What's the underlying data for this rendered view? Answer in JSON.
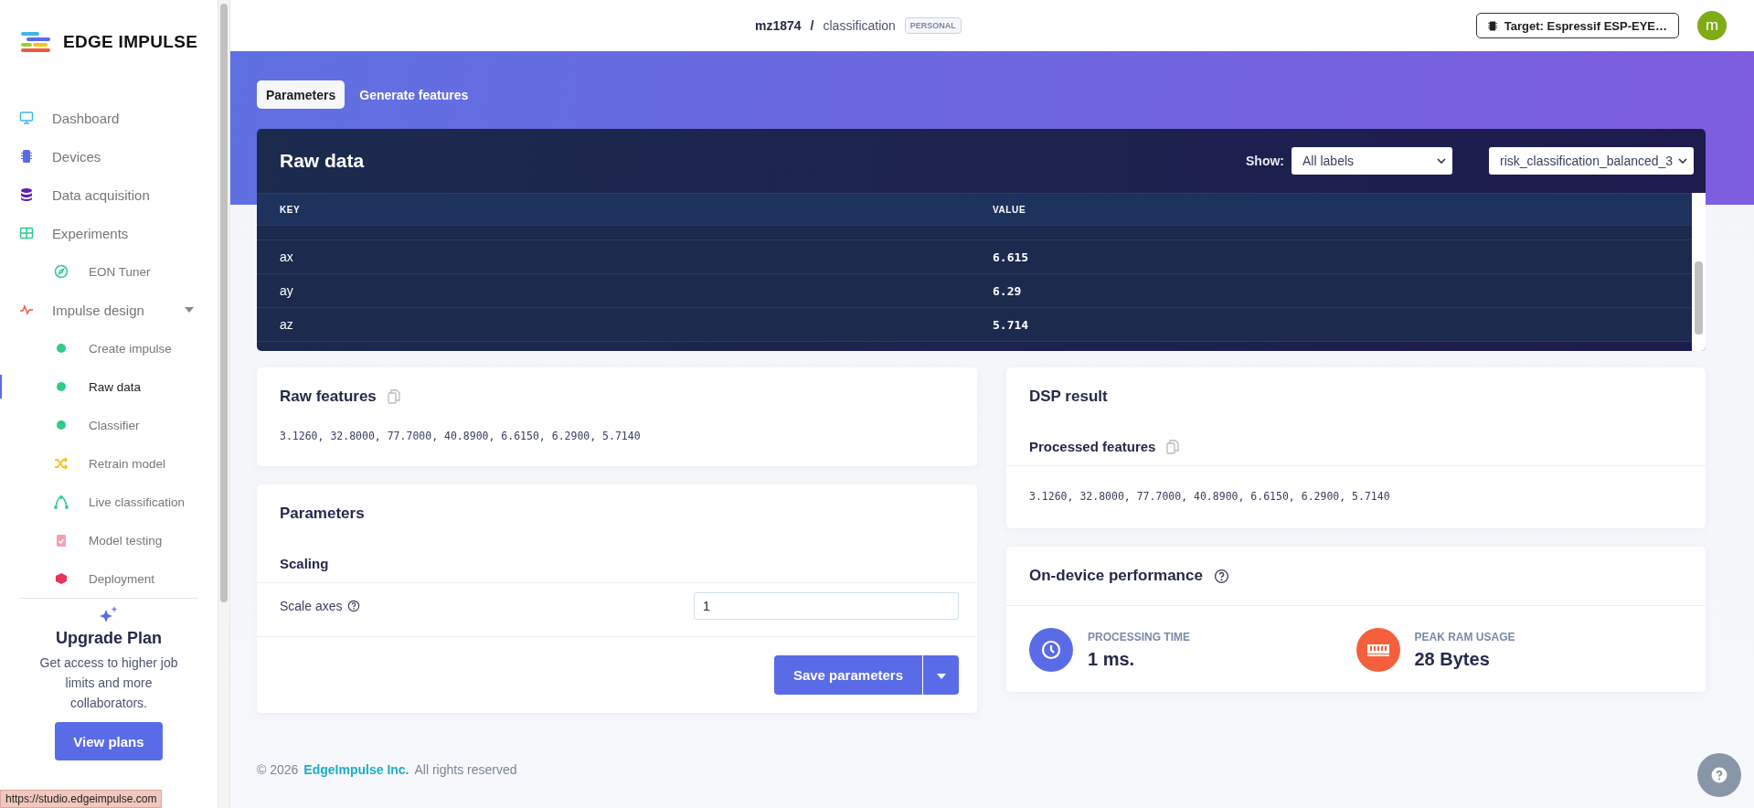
{
  "brand": {
    "name": "EDGE IMPULSE"
  },
  "sidebar": {
    "items": [
      {
        "label": "Dashboard",
        "selected": false
      },
      {
        "label": "Devices",
        "selected": false
      },
      {
        "label": "Data acquisition",
        "selected": false
      },
      {
        "label": "Experiments",
        "selected": false,
        "children": [
          {
            "label": "EON Tuner",
            "kind": "icon",
            "selected": false
          }
        ]
      },
      {
        "label": "Impulse design",
        "selected": false,
        "expanded": true,
        "children": [
          {
            "label": "Create impulse",
            "kind": "dot",
            "selected": false
          },
          {
            "label": "Raw data",
            "kind": "dot",
            "selected": true
          },
          {
            "label": "Classifier",
            "kind": "dot",
            "selected": false
          },
          {
            "label": "Retrain model",
            "kind": "icon",
            "selected": false
          },
          {
            "label": "Live classification",
            "kind": "icon",
            "selected": false
          },
          {
            "label": "Model testing",
            "kind": "icon",
            "selected": false
          },
          {
            "label": "Deployment",
            "kind": "icon",
            "selected": false
          }
        ]
      }
    ]
  },
  "upgrade": {
    "title": "Upgrade Plan",
    "text": "Get access to higher job limits and more collaborators.",
    "button": "View plans"
  },
  "status_bar": {
    "url": "https://studio.edgeimpulse.com"
  },
  "header": {
    "user": "mz1874",
    "separator": "/",
    "project": "classification",
    "badge": "PERSONAL",
    "target": "Target: Espressif ESP-EYE…",
    "avatar": "m"
  },
  "tabs": [
    {
      "label": "Parameters",
      "selected": true
    },
    {
      "label": "Generate features",
      "selected": false
    }
  ],
  "raw_data": {
    "title": "Raw data",
    "show_label": "Show:",
    "filter": "All labels",
    "sample": "risk_classification_balanced_3",
    "columns": [
      "KEY",
      "VALUE"
    ],
    "rows": [
      {
        "key": "ax",
        "value": "6.615"
      },
      {
        "key": "ay",
        "value": "6.29"
      },
      {
        "key": "az",
        "value": "5.714"
      }
    ]
  },
  "raw_features": {
    "title": "Raw features",
    "values": "3.1260, 32.8000, 77.7000, 40.8900, 6.6150, 6.2900, 5.7140"
  },
  "parameters": {
    "title": "Parameters",
    "section": "Scaling",
    "field_label": "Scale axes",
    "field_value": "1",
    "save": "Save parameters"
  },
  "dsp_result": {
    "title": "DSP result",
    "subtitle": "Processed features",
    "values": "3.1260, 32.8000, 77.7000, 40.8900, 6.6150, 6.2900, 5.7140"
  },
  "performance": {
    "title": "On-device performance",
    "metrics": [
      {
        "label": "PROCESSING TIME",
        "value": "1 ms."
      },
      {
        "label": "PEAK RAM USAGE",
        "value": "28 Bytes"
      }
    ]
  },
  "footer": {
    "copyright": "© 2026",
    "company": "EdgeImpulse Inc.",
    "rights": "All rights reserved"
  }
}
